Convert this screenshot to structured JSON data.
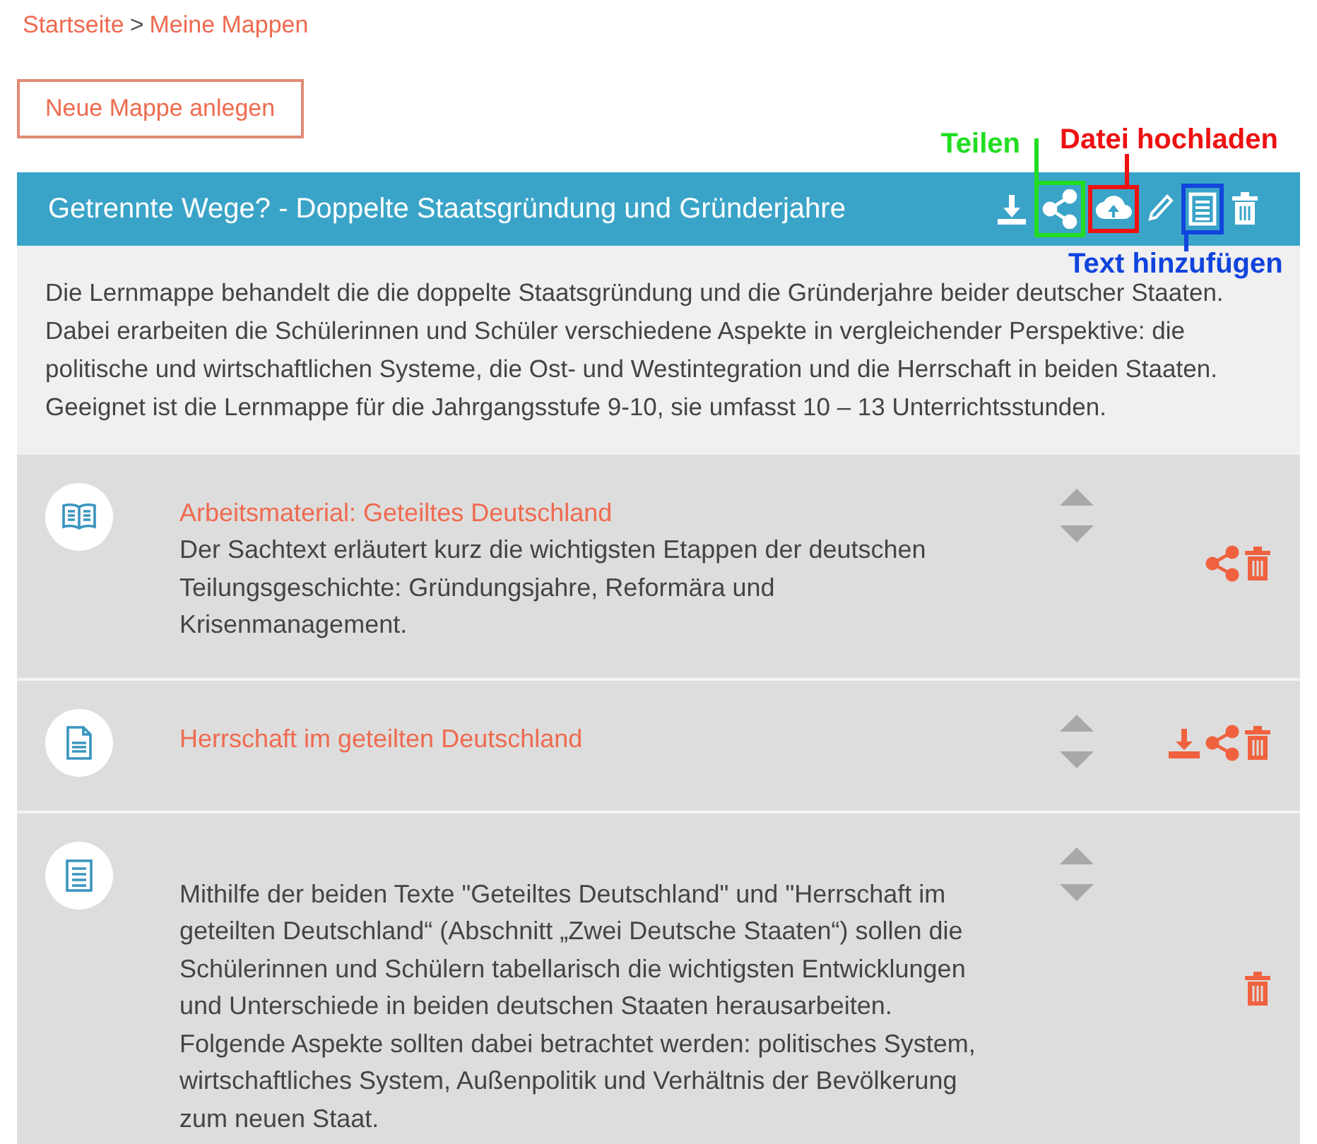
{
  "breadcrumb": [
    {
      "label": "Startseite"
    },
    {
      "label": "Meine Mappen"
    }
  ],
  "breadcrumb_separator": ">",
  "new_button": "Neue Mappe anlegen",
  "folder": {
    "title": "Getrennte Wege? - Doppelte Staatsgründung und Gründerjahre",
    "actions": [
      {
        "kind": "download"
      },
      {
        "kind": "share",
        "callout": {
          "text": "Teilen",
          "color": "#22dd22"
        }
      },
      {
        "kind": "upload",
        "callout": {
          "text": "Datei hochladen",
          "color": "#ee1111"
        }
      },
      {
        "kind": "edit"
      },
      {
        "kind": "text",
        "callout": {
          "text": "Text hinzufügen",
          "color": "#1144dd"
        }
      },
      {
        "kind": "trash"
      }
    ],
    "description": "Die Lernmappe behandelt die die doppelte Staatsgründung und die Gründerjahre beider deutscher Staaten. Dabei erarbeiten die Schülerinnen und Schüler verschiedene Aspekte in vergleichender Perspektive: die politische und wirtschaftlichen Systeme, die Ost- und Westintegration und die Herrschaft in beiden Staaten. Geeignet ist die Lernmappe für die Jahrgangsstufe 9-10, sie umfasst 10 – 13 Unterrichtsstunden."
  },
  "items": [
    {
      "kind": "book",
      "title": "Arbeitsmaterial: Geteiltes Deutschland",
      "text": "Der Sachtext erläutert kurz die wichtigsten Etappen der deutschen Teilungsgeschichte: Gründungsjahre, Reformära und Krisenmanagement.",
      "actions": [
        {
          "kind": "share"
        },
        {
          "kind": "trash"
        }
      ]
    },
    {
      "kind": "file",
      "title": "Herrschaft im geteilten Deutschland",
      "actions": [
        {
          "kind": "download"
        },
        {
          "kind": "share"
        },
        {
          "kind": "trash"
        }
      ]
    },
    {
      "kind": "text",
      "text": "Mithilfe der beiden Texte \"Geteiltes Deutschland\" und \"Herrschaft im geteilten Deutschland“ (Abschnitt „Zwei Deutsche Staaten“) sollen die Schülerinnen und Schülern tabellarisch die wichtigsten Entwicklungen und Unterschiede in beiden deutschen Staaten herausarbeiten. Folgende Aspekte sollten dabei betrachtet werden: politisches System, wirtschaftliches System, Außenpolitik und Verhältnis der Bevölkerung zum neuen Staat.",
      "actions": [
        {
          "kind": "trash"
        }
      ]
    }
  ]
}
